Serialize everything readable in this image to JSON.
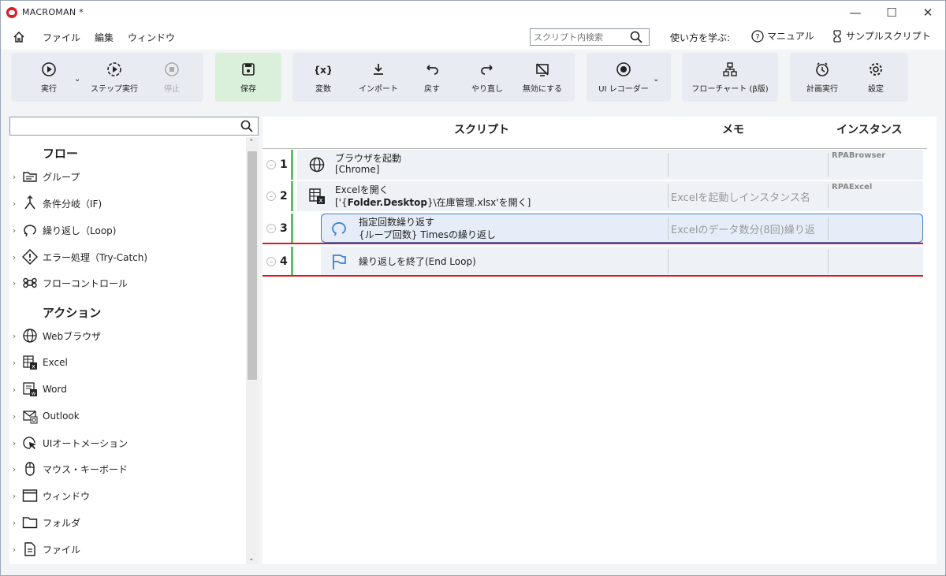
{
  "app": {
    "title": "MACROMAN *"
  },
  "window_controls": {
    "minimize": "—",
    "maximize": "☐",
    "close": "✕"
  },
  "menu": {
    "items": [
      "ファイル",
      "編集",
      "ウィンドウ"
    ],
    "search_placeholder": "スクリプト内検索",
    "help_label": "使い方を学ぶ:",
    "manual_label": "マニュアル",
    "sample_label": "サンプルスクリプト"
  },
  "toolbar": {
    "run": "実行",
    "step_run": "ステップ実行",
    "stop": "停止",
    "save": "保存",
    "variable": "変数",
    "import": "インポート",
    "undo": "戻す",
    "redo": "やり直し",
    "disable": "無効にする",
    "ui_recorder": "UI レコーダー",
    "flowchart": "フローチャート (β版)",
    "schedule": "計画実行",
    "settings": "設定",
    "save_color": "#dbf0db"
  },
  "left_panel": {
    "flow_header": "フロー",
    "flow_items": [
      "グループ",
      "条件分岐（IF)",
      "繰り返し（Loop)",
      "エラー処理（Try-Catch)",
      "フローコントロール"
    ],
    "action_header": "アクション",
    "action_items": [
      "Webブラウザ",
      "Excel",
      "Word",
      "Outlook",
      "UIオートメーション",
      "マウス・キーボード",
      "ウィンドウ",
      "フォルダ",
      "ファイル"
    ]
  },
  "script_table": {
    "headers": {
      "script": "スクリプト",
      "memo": "メモ",
      "instance": "インスタンス"
    },
    "rows": [
      {
        "num": "1",
        "icon": "globe-icon",
        "line1": "ブラウザを起動",
        "line2": "[Chrome]",
        "memo": "",
        "instance": "RPABrowser"
      },
      {
        "num": "2",
        "icon": "excel-icon",
        "line1": "Excelを開く",
        "line2_pre": "['{",
        "line2_bold": "Folder.Desktop",
        "line2_post": "}\\在庫管理.xlsx'を開く]",
        "memo": "Excelを起動しインスタンス名",
        "instance": "RPAExcel"
      },
      {
        "num": "3",
        "icon": "loop-icon",
        "line1": "指定回数繰り返す",
        "line2": "{ループ回数} Timesの繰り返し",
        "memo": "Excelのデータ数分(8回)繰り返",
        "instance": ""
      },
      {
        "num": "4",
        "icon": "flag-icon",
        "line1": "繰り返しを終了(End Loop)",
        "memo": "",
        "instance": ""
      }
    ]
  },
  "colors": {
    "accent": "#3a82d6",
    "highlight_red": "#e0141e",
    "row_bar_green": "#5cbf6b"
  }
}
